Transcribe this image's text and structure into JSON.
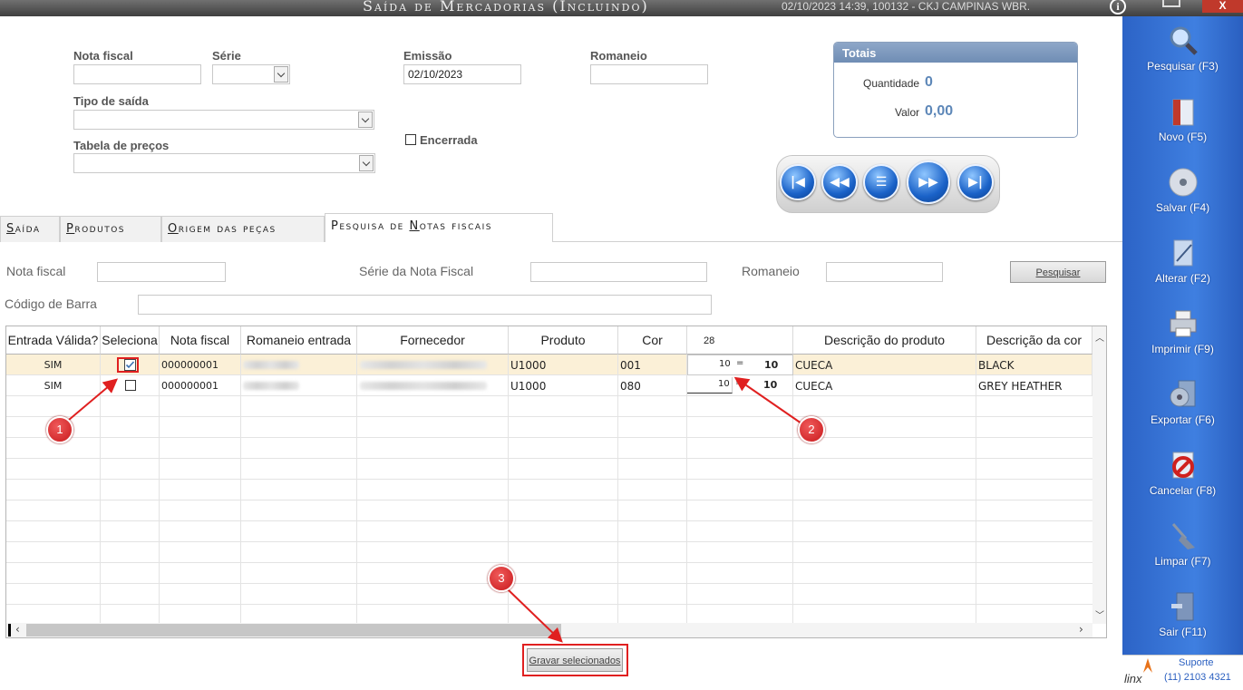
{
  "titlebar": {
    "title": "Saída de Mercadorias (Incluindo)",
    "info": "02/10/2023 14:39, 100132 - CKJ CAMPINAS WBR.",
    "info_icon": "i",
    "close_label": "X"
  },
  "form": {
    "nota_fiscal_label": "Nota fiscal",
    "nota_fiscal_value": "",
    "serie_label": "Série",
    "serie_value": "",
    "emissao_label": "Emissão",
    "emissao_value": "02/10/2023",
    "romaneio_label": "Romaneio",
    "romaneio_value": "",
    "tipo_saida_label": "Tipo de saída",
    "tipo_saida_value": "",
    "tabela_precos_label": "Tabela de preços",
    "tabela_precos_value": "",
    "encerrada_label": "Encerrada"
  },
  "totais": {
    "title": "Totais",
    "quantidade_label": "Quantidade",
    "quantidade_value": "0",
    "valor_label": "Valor",
    "valor_value": "0,00"
  },
  "nav_buttons": [
    "first",
    "previous",
    "list",
    "next",
    "last"
  ],
  "tabs": [
    {
      "pre": "",
      "key": "S",
      "rest": "aída",
      "active": false
    },
    {
      "pre": "",
      "key": "P",
      "rest": "rodutos",
      "active": false
    },
    {
      "pre": "",
      "key": "O",
      "rest": "rigem das peças",
      "active": false
    },
    {
      "pre": "Pesquisa de ",
      "key": "N",
      "rest": "otas fiscais",
      "active": true
    }
  ],
  "search": {
    "nota_fiscal_label": "Nota fiscal",
    "serie_label": "Série da Nota Fiscal",
    "romaneio_label": "Romaneio",
    "codigo_barra_label": "Código de Barra",
    "pesquisar_button": "Pesquisar"
  },
  "grid": {
    "columns": [
      "Entrada Válida?",
      "Seleciona",
      "Nota fiscal",
      "Romaneio entrada",
      "Fornecedor",
      "Produto",
      "Cor",
      "28",
      "Descrição do produto",
      "Descrição da cor"
    ],
    "rows": [
      {
        "entrada_valida": "SIM",
        "seleciona": true,
        "nota_fiscal": "000000001",
        "romaneio": "",
        "fornecedor": "",
        "produto": "U1000",
        "cor": "001",
        "qtd_a": "10",
        "eq": "=",
        "qtd_b": "10",
        "descricao_produto": "CUECA",
        "descricao_cor": "BLACK"
      },
      {
        "entrada_valida": "SIM",
        "seleciona": false,
        "nota_fiscal": "000000001",
        "romaneio": "",
        "fornecedor": "",
        "produto": "U1000",
        "cor": "080",
        "qtd_a": "10",
        "eq": "=",
        "qtd_b": "10",
        "descricao_produto": "CUECA",
        "descricao_cor": "GREY HEATHER"
      }
    ]
  },
  "gravar_button": "Gravar selecionados",
  "annotations": [
    "1",
    "2",
    "3"
  ],
  "sidebar": [
    {
      "label": "Pesquisar (F3)",
      "icon": "magnifier-icon"
    },
    {
      "label": "Novo (F5)",
      "icon": "new-document-icon"
    },
    {
      "label": "Salvar (F4)",
      "icon": "disc-save-icon"
    },
    {
      "label": "Alterar (F2)",
      "icon": "edit-document-icon"
    },
    {
      "label": "Imprimir (F9)",
      "icon": "printer-icon"
    },
    {
      "label": "Exportar (F6)",
      "icon": "export-disc-icon"
    },
    {
      "label": "Cancelar (F8)",
      "icon": "cancel-icon"
    },
    {
      "label": "Limpar (F7)",
      "icon": "broom-icon"
    },
    {
      "label": "Sair (F11)",
      "icon": "exit-door-icon"
    }
  ],
  "suporte": {
    "logo": "linx",
    "label": "Suporte",
    "phone": "(11) 2103 4321"
  },
  "colors": {
    "accent_blue": "#3f7fe0",
    "annotation_red": "#e02020",
    "selected_row": "#fbf0d7"
  }
}
